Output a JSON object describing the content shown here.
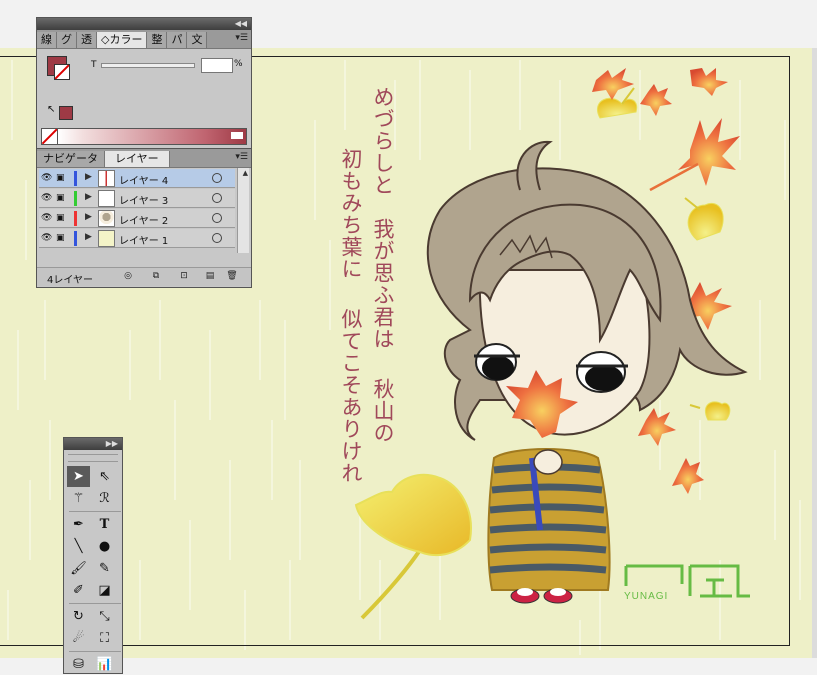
{
  "color_panel": {
    "tabs": [
      "線",
      "グ",
      "透",
      "カラー",
      "整",
      "パ",
      "文"
    ],
    "active_tab": 3,
    "tab_prefix": "◇",
    "t_label": "T",
    "percent_sign": "%",
    "fill_color": "#9e3a45",
    "menu_icon": "panel-menu-icon"
  },
  "layers_panel": {
    "tabs": [
      "ナビゲータ",
      "レイヤー"
    ],
    "active_tab": 1,
    "layers": [
      {
        "name": "レイヤー 4",
        "color": "#3355dd",
        "selected": true,
        "thumb": "stroke"
      },
      {
        "name": "レイヤー 3",
        "color": "#33cc33",
        "selected": false,
        "thumb": "blank"
      },
      {
        "name": "レイヤー 2",
        "color": "#ee3333",
        "selected": false,
        "thumb": "character"
      },
      {
        "name": "レイヤー 1",
        "color": "#3355dd",
        "selected": false,
        "thumb": "yellow"
      }
    ],
    "footer_label": "4レイヤー"
  },
  "artwork": {
    "poem_columns": [
      "めづらしと",
      "我が思ふ君は",
      "秋山の",
      "初もみち葉に",
      "似てこそありけれ"
    ],
    "logo_text": "YUNAGI",
    "colors": {
      "background": "#eef0c8",
      "poem": "#a0485a",
      "hair": "#b0a48e",
      "skin": "#f6eede",
      "kimono_gold": "#c9a032",
      "kimono_stripe": "#4a5a66",
      "ginkgo": "#eedd33",
      "maple": "#e8603a",
      "logo": "#66bb44"
    }
  },
  "tools": [
    "selection-tool",
    "direct-selection-tool",
    "magic-wand-tool",
    "lasso-tool",
    "pen-tool",
    "type-tool",
    "line-tool",
    "ellipse-tool",
    "paintbrush-tool",
    "pencil-tool",
    "blob-brush-tool",
    "eraser-tool",
    "rotate-tool",
    "scale-tool",
    "warp-tool",
    "free-transform-tool",
    "symbol-sprayer-tool",
    "column-graph-tool"
  ]
}
